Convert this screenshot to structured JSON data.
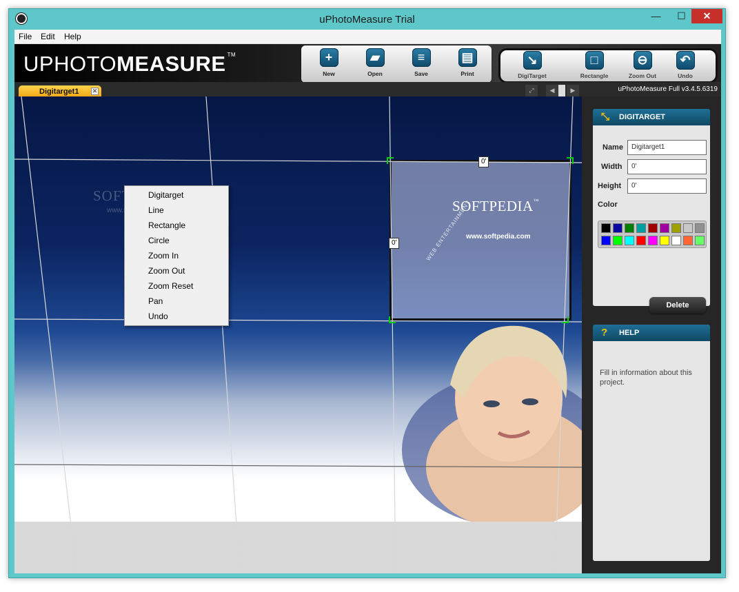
{
  "window": {
    "title": "uPhotoMeasure Trial",
    "min": "—",
    "max": "☐",
    "close": "✕"
  },
  "menubar": {
    "file": "File",
    "edit": "Edit",
    "help": "Help"
  },
  "logo": {
    "light": "U",
    "mid": "PHOTO",
    "bold": "MEASURE",
    "tm": "TM"
  },
  "toolbar": {
    "new": "New",
    "open": "Open",
    "save": "Save",
    "print": "Print"
  },
  "tools": {
    "digitarget": "DigiTarget",
    "rectangle": "Rectangle",
    "zoom_out": "Zoom Out",
    "undo": "Undo"
  },
  "tab": {
    "label": "Digitarget1",
    "close": "✕"
  },
  "version": "uPhotoMeasure Full v3.4.5.6319",
  "photo": {
    "wm": "SOFTPEDIA",
    "wm_sub": "www.softpedia.com",
    "sel_title": "SOFTPEDIA",
    "sel_tm": "™",
    "sel_url": "www.softpedia.com",
    "sel_web": "WEB ENTERTAINMENT"
  },
  "dims": {
    "top": "0'",
    "left": "0'"
  },
  "context_menu": [
    "Digitarget",
    "Line",
    "Rectangle",
    "Circle",
    "Zoom In",
    "Zoom Out",
    "Zoom Reset",
    "Pan",
    "Undo"
  ],
  "digitarget_panel": {
    "title": "DIGITARGET",
    "name_label": "Name",
    "name_value": "Digitarget1",
    "width_label": "Width",
    "width_value": "0'",
    "height_label": "Height",
    "height_value": "0'",
    "color_label": "Color",
    "delete": "Delete"
  },
  "palette": {
    "row1": [
      "#000000",
      "#0a0aa0",
      "#008000",
      "#00a0a0",
      "#a00000",
      "#a000a0",
      "#a0a000",
      "#c8c8c8",
      "#909090"
    ],
    "row2": [
      "#0000ff",
      "#00ff00",
      "#00ffff",
      "#ff0000",
      "#ff00ff",
      "#ffff00",
      "#ffffff",
      "#ff6633",
      "#66ff66"
    ]
  },
  "help_panel": {
    "title": "HELP",
    "text": "Fill in information about this project."
  },
  "colors": {
    "accent": "#f2a410",
    "panel_head": "#1f6f96",
    "window": "#5dc7c9"
  }
}
